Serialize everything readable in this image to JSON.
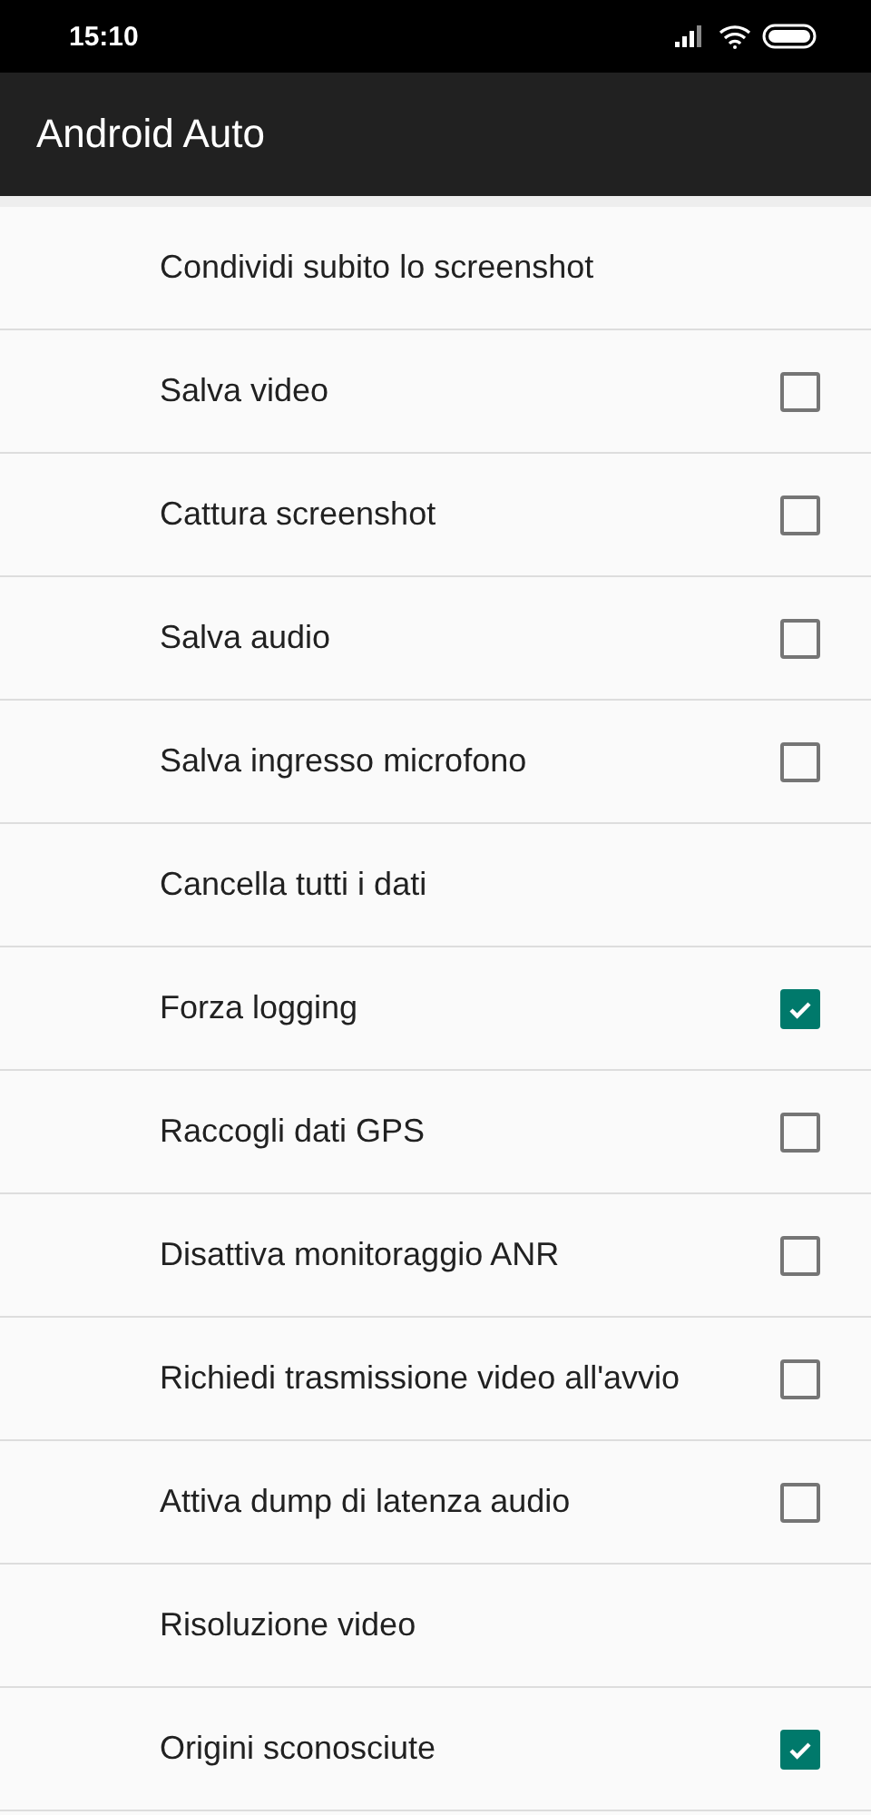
{
  "status_bar": {
    "time": "15:10"
  },
  "toolbar": {
    "title": "Android Auto"
  },
  "settings": [
    {
      "label": "Condividi subito lo screenshot",
      "kind": "action"
    },
    {
      "label": "Salva video",
      "kind": "checkbox",
      "checked": false
    },
    {
      "label": "Cattura screenshot",
      "kind": "checkbox",
      "checked": false
    },
    {
      "label": "Salva audio",
      "kind": "checkbox",
      "checked": false
    },
    {
      "label": "Salva ingresso microfono",
      "kind": "checkbox",
      "checked": false
    },
    {
      "label": "Cancella tutti i dati",
      "kind": "action"
    },
    {
      "label": "Forza logging",
      "kind": "checkbox",
      "checked": true
    },
    {
      "label": "Raccogli dati GPS",
      "kind": "checkbox",
      "checked": false
    },
    {
      "label": "Disattiva monitoraggio ANR",
      "kind": "checkbox",
      "checked": false
    },
    {
      "label": "Richiedi trasmissione video all'avvio",
      "kind": "checkbox",
      "checked": false
    },
    {
      "label": "Attiva dump di latenza audio",
      "kind": "checkbox",
      "checked": false
    },
    {
      "label": "Risoluzione video",
      "kind": "action"
    },
    {
      "label": "Origini sconosciute",
      "kind": "checkbox",
      "checked": true
    }
  ]
}
